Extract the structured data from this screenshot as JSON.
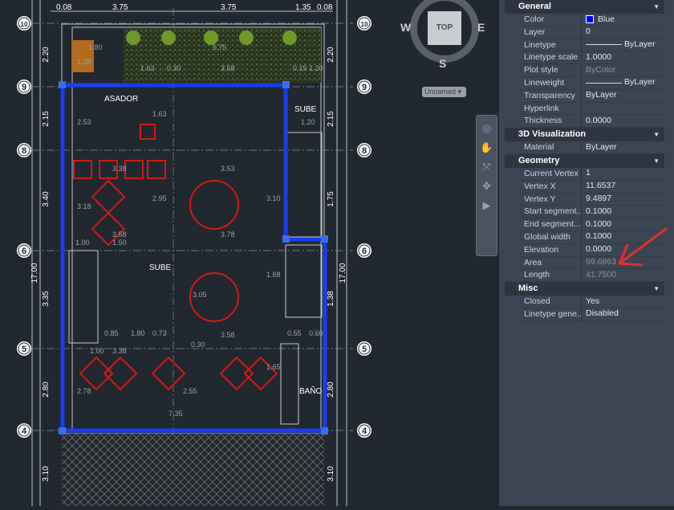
{
  "drawing": {
    "top_dims": [
      "0.08",
      "3.75",
      "3.75",
      "1.35",
      "0.08"
    ],
    "side_dims": [
      "2.20",
      "2.15",
      "3.40",
      "3.35",
      "2.80",
      "3.10"
    ],
    "right_dims": [
      "2.20",
      "2.15",
      "1.75",
      "1.38",
      "2.80",
      "3.10"
    ],
    "total_dim": "17.00",
    "grid_labels": [
      "10",
      "9",
      "8",
      "6",
      "5",
      "4"
    ],
    "rooms": {
      "asador": "ASADOR",
      "sube1": "SUBE",
      "sube2": "SUBE",
      "bano": "BAÑO"
    },
    "inner_dims": [
      "1.80",
      "1.38",
      "6.75",
      "1.63",
      "0.30",
      "3.58",
      "0.15",
      "1.20",
      "2.53",
      "1.63",
      "3.38",
      "3.53",
      "2.95",
      "3.18",
      "3.58",
      "1.00",
      "1.50",
      "3.78",
      "3.05",
      "3.58",
      "0.85",
      "1.80",
      "0.73",
      "0.30",
      "1.00",
      "3.38",
      "2.78",
      "2.55",
      "7.35",
      "1.65",
      "0.55",
      "0.60",
      "1.20",
      "1.68",
      "3.10"
    ],
    "colors": {
      "wall": "#1a3df0",
      "furniture": "#e01b1b",
      "lines": "#c8ccd0",
      "grass": "#2e3a22"
    }
  },
  "viewcube": {
    "top": "TOP",
    "w": "W",
    "e": "E",
    "s": "S",
    "ucs": "Unnamed"
  },
  "properties": {
    "sections": [
      {
        "title": "General",
        "rows": [
          {
            "k": "Color",
            "v": "Blue",
            "type": "color"
          },
          {
            "k": "Layer",
            "v": "0"
          },
          {
            "k": "Linetype",
            "v": "ByLayer",
            "type": "line"
          },
          {
            "k": "Linetype scale",
            "v": "1.0000"
          },
          {
            "k": "Plot style",
            "v": "ByColor",
            "dim": true
          },
          {
            "k": "Lineweight",
            "v": "ByLayer",
            "type": "line"
          },
          {
            "k": "Transparency",
            "v": "ByLayer"
          },
          {
            "k": "Hyperlink",
            "v": ""
          },
          {
            "k": "Thickness",
            "v": "0.0000"
          }
        ]
      },
      {
        "title": "3D Visualization",
        "rows": [
          {
            "k": "Material",
            "v": "ByLayer"
          }
        ]
      },
      {
        "title": "Geometry",
        "rows": [
          {
            "k": "Current Vertex",
            "v": "1"
          },
          {
            "k": "Vertex X",
            "v": "11.6537"
          },
          {
            "k": "Vertex Y",
            "v": "9.4897"
          },
          {
            "k": "Start  segment...",
            "v": "0.1000"
          },
          {
            "k": "End  segment...",
            "v": "0.1000"
          },
          {
            "k": "Global width",
            "v": "0.1000"
          },
          {
            "k": "Elevation",
            "v": "0.0000"
          },
          {
            "k": "Area",
            "v": "99.6863",
            "dim": true
          },
          {
            "k": "Length",
            "v": "41.7500",
            "dim": true
          }
        ]
      },
      {
        "title": "Misc",
        "rows": [
          {
            "k": "Closed",
            "v": "Yes"
          },
          {
            "k": "Linetype gene...",
            "v": "Disabled"
          }
        ]
      }
    ]
  }
}
